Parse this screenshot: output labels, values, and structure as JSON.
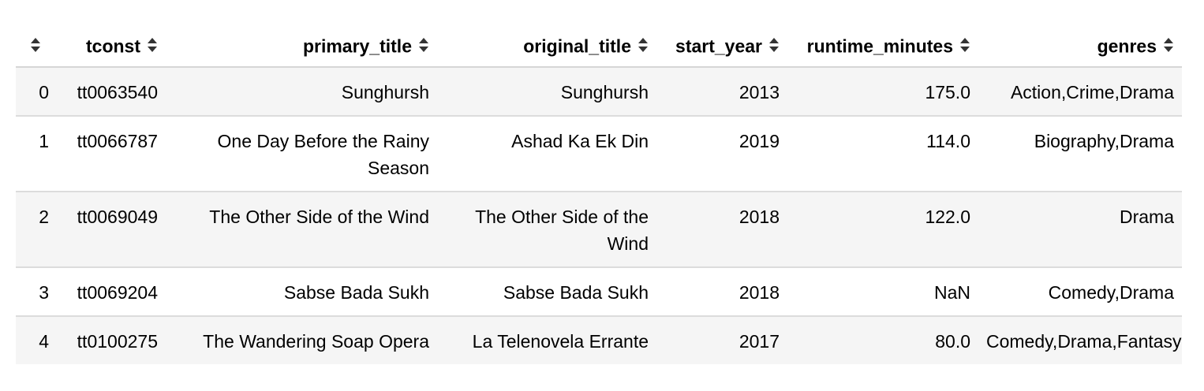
{
  "table": {
    "columns": [
      "",
      "tconst",
      "primary_title",
      "original_title",
      "start_year",
      "runtime_minutes",
      "genres"
    ],
    "sort_icon": "sort-icon",
    "rows": [
      [
        "0",
        "tt0063540",
        "Sunghursh",
        "Sunghursh",
        "2013",
        "175.0",
        "Action,Crime,Drama"
      ],
      [
        "1",
        "tt0066787",
        "One Day Before the Rainy Season",
        "Ashad Ka Ek Din",
        "2019",
        "114.0",
        "Biography,Drama"
      ],
      [
        "2",
        "tt0069049",
        "The Other Side of the Wind",
        "The Other Side of the Wind",
        "2018",
        "122.0",
        "Drama"
      ],
      [
        "3",
        "tt0069204",
        "Sabse Bada Sukh",
        "Sabse Bada Sukh",
        "2018",
        "NaN",
        "Comedy,Drama"
      ],
      [
        "4",
        "tt0100275",
        "The Wandering Soap Opera",
        "La Telenovela Errante",
        "2017",
        "80.0",
        "Comedy,Drama,Fantasy"
      ]
    ]
  }
}
